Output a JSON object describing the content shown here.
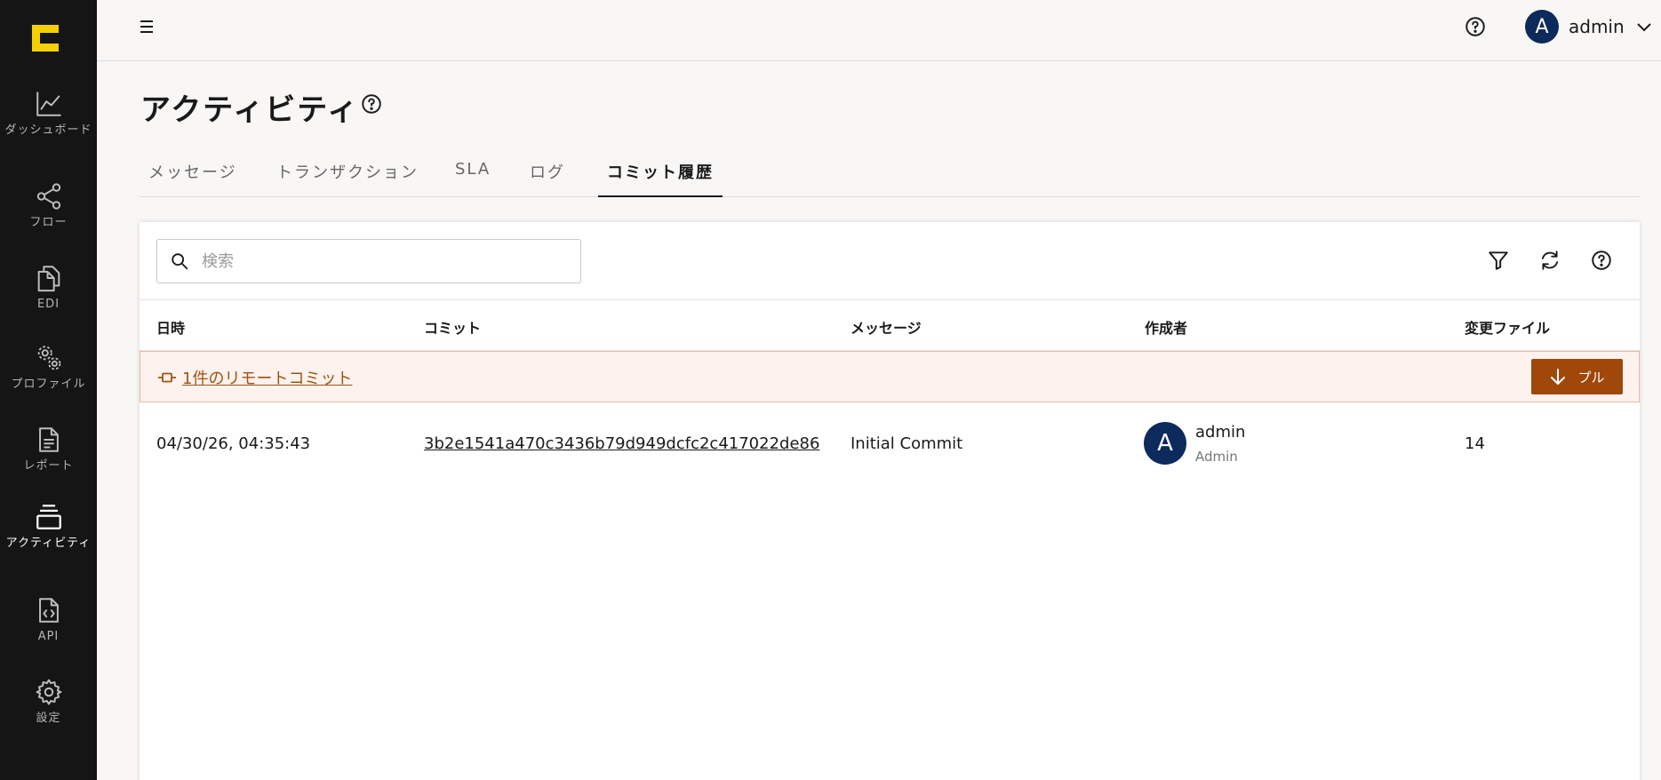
{
  "sidebar": {
    "items": [
      {
        "label": "ダッシュボード"
      },
      {
        "label": "フロー"
      },
      {
        "label": "EDI"
      },
      {
        "label": "プロファイル"
      },
      {
        "label": "レポート"
      },
      {
        "label": "アクティビティ"
      },
      {
        "label": "API"
      },
      {
        "label": "設定"
      }
    ],
    "active_index": 5
  },
  "header": {
    "user_initial": "A",
    "user_name": "admin"
  },
  "page": {
    "title": "アクティビティ"
  },
  "tabs": [
    {
      "label": "メッセージ"
    },
    {
      "label": "トランザクション"
    },
    {
      "label": "SLA"
    },
    {
      "label": "ログ"
    },
    {
      "label": "コミット履歴"
    }
  ],
  "active_tab": 4,
  "search": {
    "placeholder": "検索",
    "value": ""
  },
  "table": {
    "columns": [
      "日時",
      "コミット",
      "メッセージ",
      "作成者",
      "変更ファイル"
    ],
    "remote_banner": {
      "text": "1件のリモートコミット",
      "pull_label": "プル"
    },
    "rows": [
      {
        "datetime": "04/30/26, 04:35:43",
        "commit": "3b2e1541a470c3436b79d949dcfc2c417022de86",
        "message": "Initial Commit",
        "author_initial": "A",
        "author_name": "admin",
        "author_role": "Admin",
        "files_changed": "14"
      }
    ]
  },
  "colors": {
    "sidebar_bg": "#151515",
    "logo": "#f5d000",
    "avatar": "#0d2a5c",
    "accent": "#a0470a",
    "banner_bg": "#fdf2ee"
  }
}
